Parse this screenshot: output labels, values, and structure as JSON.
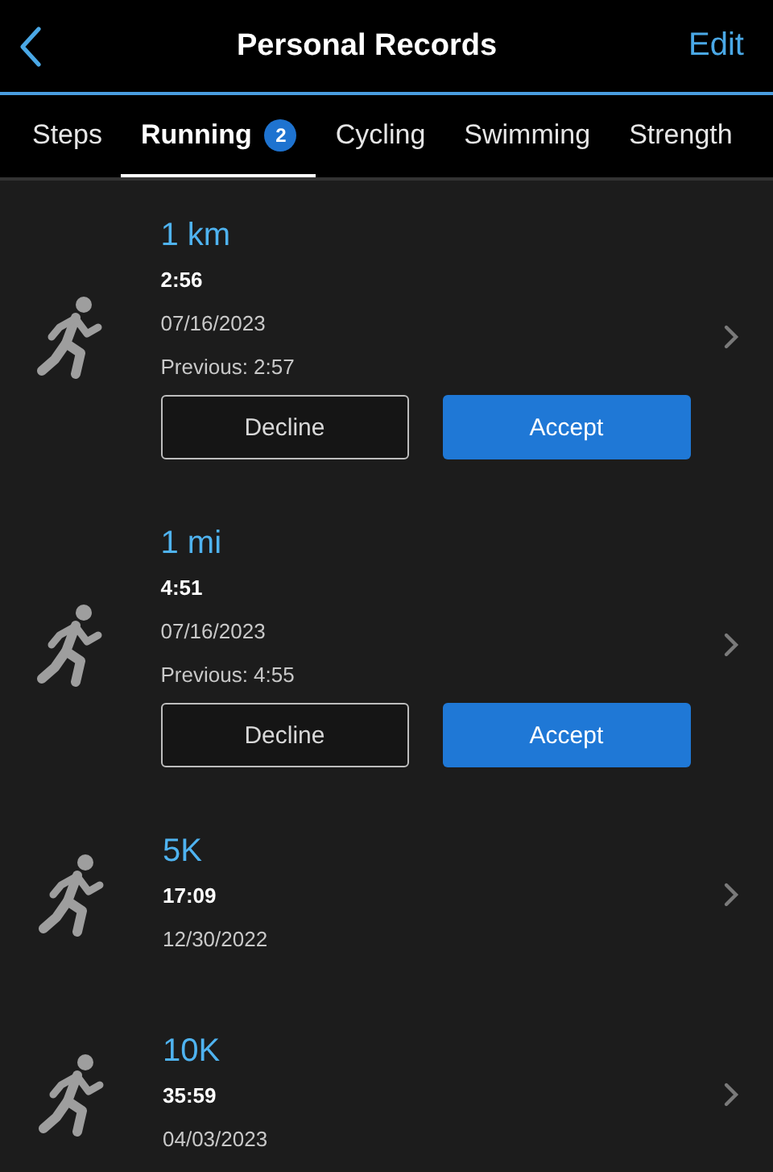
{
  "header": {
    "title": "Personal Records",
    "edit": "Edit"
  },
  "tabs": [
    {
      "label": "Steps",
      "selected": false
    },
    {
      "label": "Running",
      "selected": true,
      "badge": "2"
    },
    {
      "label": "Cycling",
      "selected": false
    },
    {
      "label": "Swimming",
      "selected": false
    },
    {
      "label": "Strength",
      "selected": false
    }
  ],
  "records": [
    {
      "kind": "pending",
      "distance": "1 km",
      "time": "2:56",
      "date": "07/16/2023",
      "previous": "Previous: 2:57",
      "decline": "Decline",
      "accept": "Accept"
    },
    {
      "kind": "pending",
      "distance": "1 mi",
      "time": "4:51",
      "date": "07/16/2023",
      "previous": "Previous: 4:55",
      "decline": "Decline",
      "accept": "Accept"
    },
    {
      "kind": "plain",
      "distance": "5K",
      "time": "17:09",
      "date": "12/30/2022"
    },
    {
      "kind": "plain",
      "distance": "10K",
      "time": "35:59",
      "date": "04/03/2023"
    }
  ]
}
